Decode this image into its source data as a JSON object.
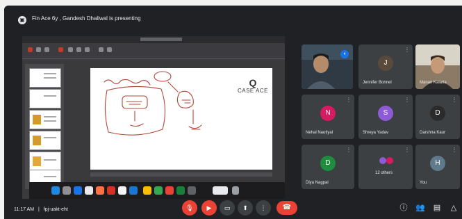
{
  "meeting": {
    "presenting_text": "Fin Ace 6y , Gandesh Dhaliwal is presenting",
    "time": "11:17 AM",
    "meeting_code": "fpj-uakt-eht"
  },
  "slide": {
    "brand_mark": "Q",
    "brand_name": "CASE ACE"
  },
  "participants": [
    {
      "name": "",
      "initial": "",
      "color": "#2f3a44",
      "has_video": true,
      "speaking": true
    },
    {
      "name": "Jennifer Bonnel",
      "initial": "J",
      "color": "#5a4a3c",
      "has_video": false,
      "speaking": false
    },
    {
      "name": "Manan Kalaria",
      "initial": "",
      "color": "#6b5a4a",
      "has_video": true,
      "speaking": false
    },
    {
      "name": "Nehal Nautiyal",
      "initial": "N",
      "color": "#d81b60",
      "has_video": false,
      "speaking": false
    },
    {
      "name": "Shreya Yadav",
      "initial": "S",
      "color": "#8e5bd6",
      "has_video": false,
      "speaking": false
    },
    {
      "name": "Darshna Kaur",
      "initial": "D",
      "color": "#2b2b2b",
      "has_video": false,
      "speaking": false
    },
    {
      "name": "Diya Nagpal",
      "initial": "D",
      "color": "#1e8e3e",
      "has_video": false,
      "speaking": false
    },
    {
      "name": "12 others",
      "initial": "",
      "color": "#3c4043",
      "has_video": false,
      "speaking": false
    },
    {
      "name": "You",
      "initial": "H",
      "color": "#5f7a8a",
      "has_video": false,
      "speaking": false
    }
  ],
  "controls": {
    "mic": "mic-off",
    "camera": "camera-off",
    "captions": "captions",
    "present": "present",
    "more": "more",
    "end_call": "end-call"
  },
  "right_icons": [
    "info",
    "people",
    "chat",
    "activities"
  ],
  "colors": {
    "stage": "#202124",
    "tile": "#3c4043",
    "danger": "#ea4335",
    "accent": "#1a73e8"
  }
}
